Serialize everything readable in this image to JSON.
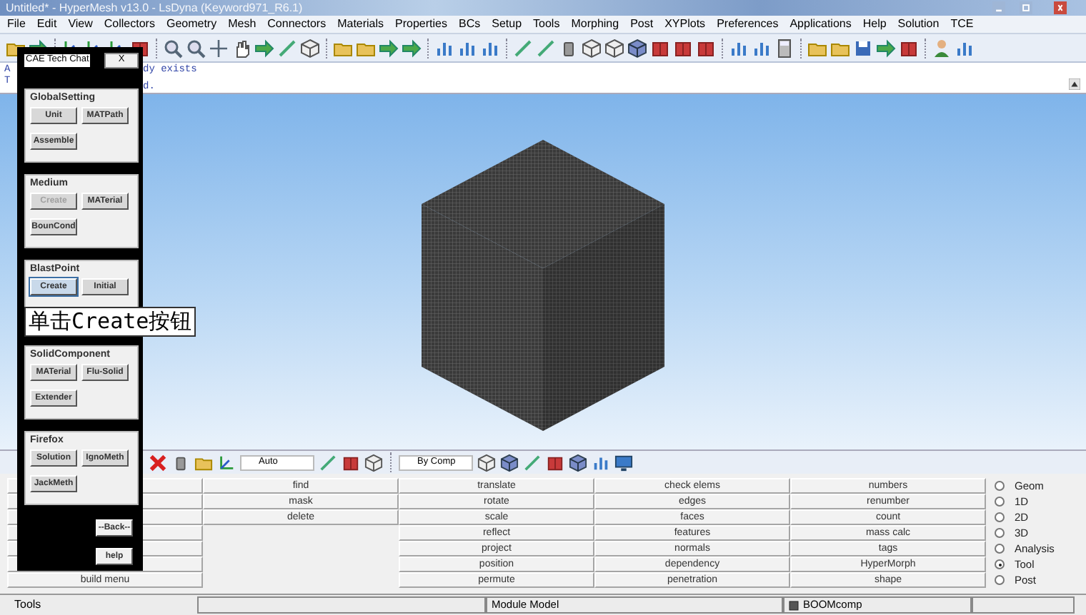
{
  "window": {
    "title": "Untitled* - HyperMesh v13.0 - LsDyna (Keyword971_R6.1)"
  },
  "menu": [
    "File",
    "Edit",
    "View",
    "Collectors",
    "Geometry",
    "Mesh",
    "Connectors",
    "Materials",
    "Properties",
    "BCs",
    "Setup",
    "Tools",
    "Morphing",
    "Post",
    "XYPlots",
    "Preferences",
    "Applications",
    "Help",
    "Solution",
    "TCE"
  ],
  "command": {
    "margin_marks": [
      "A",
      "T"
    ],
    "lines": [
      "dy exists",
      "d."
    ]
  },
  "view_toolbar": {
    "dropdowns": [
      "Auto",
      "By Comp"
    ]
  },
  "panel": {
    "left_column": {
      "label": "build menu"
    },
    "columns": [
      {
        "cells": [
          "find",
          "mask",
          "delete"
        ]
      },
      {
        "cells": [
          "translate",
          "rotate",
          "scale",
          "reflect",
          "project",
          "position",
          "permute"
        ]
      },
      {
        "cells": [
          "check elems",
          "edges",
          "faces",
          "features",
          "normals",
          "dependency",
          "penetration"
        ]
      },
      {
        "cells": [
          "numbers",
          "renumber",
          "count",
          "mass calc",
          "tags",
          "HyperMorph",
          "shape"
        ]
      }
    ],
    "radios": [
      {
        "label": "Geom",
        "selected": false
      },
      {
        "label": "1D",
        "selected": false
      },
      {
        "label": "2D",
        "selected": false
      },
      {
        "label": "3D",
        "selected": false
      },
      {
        "label": "Analysis",
        "selected": false
      },
      {
        "label": "Tool",
        "selected": true
      },
      {
        "label": "Post",
        "selected": false
      }
    ]
  },
  "status_bar": {
    "title": "Tools",
    "module": "Module Model",
    "component": "BOOMcomp"
  },
  "dialog": {
    "title": "CAE Tech Chat",
    "close": "X",
    "groups": [
      {
        "title": "GlobalSetting",
        "buttons": [
          {
            "label": "Unit",
            "disabled": false,
            "focused": false
          },
          {
            "label": "MATPath",
            "disabled": false,
            "focused": false
          },
          {
            "label": "Assemble",
            "disabled": false,
            "focused": false
          }
        ]
      },
      {
        "title": "Medium",
        "buttons": [
          {
            "label": "Create",
            "disabled": true,
            "focused": false
          },
          {
            "label": "MATerial",
            "disabled": false,
            "focused": false
          },
          {
            "label": "BounCond",
            "disabled": false,
            "focused": false
          }
        ]
      },
      {
        "title": "BlastPoint",
        "buttons": [
          {
            "label": "Create",
            "disabled": false,
            "focused": true
          },
          {
            "label": "Initial",
            "disabled": false,
            "focused": false
          }
        ]
      },
      {
        "title": "SolidComponent",
        "buttons": [
          {
            "label": "MATerial",
            "disabled": false,
            "focused": false
          },
          {
            "label": "Flu-Solid",
            "disabled": false,
            "focused": false
          },
          {
            "label": "Extender",
            "disabled": false,
            "focused": false
          }
        ]
      },
      {
        "title": "Firefox",
        "buttons": [
          {
            "label": "Solution",
            "disabled": false,
            "focused": false
          },
          {
            "label": "IgnoMeth",
            "disabled": false,
            "focused": false
          },
          {
            "label": "JackMeth",
            "disabled": false,
            "focused": false
          }
        ]
      }
    ],
    "back": "--Back--",
    "help": "help"
  },
  "caption": "单击Create按钮"
}
